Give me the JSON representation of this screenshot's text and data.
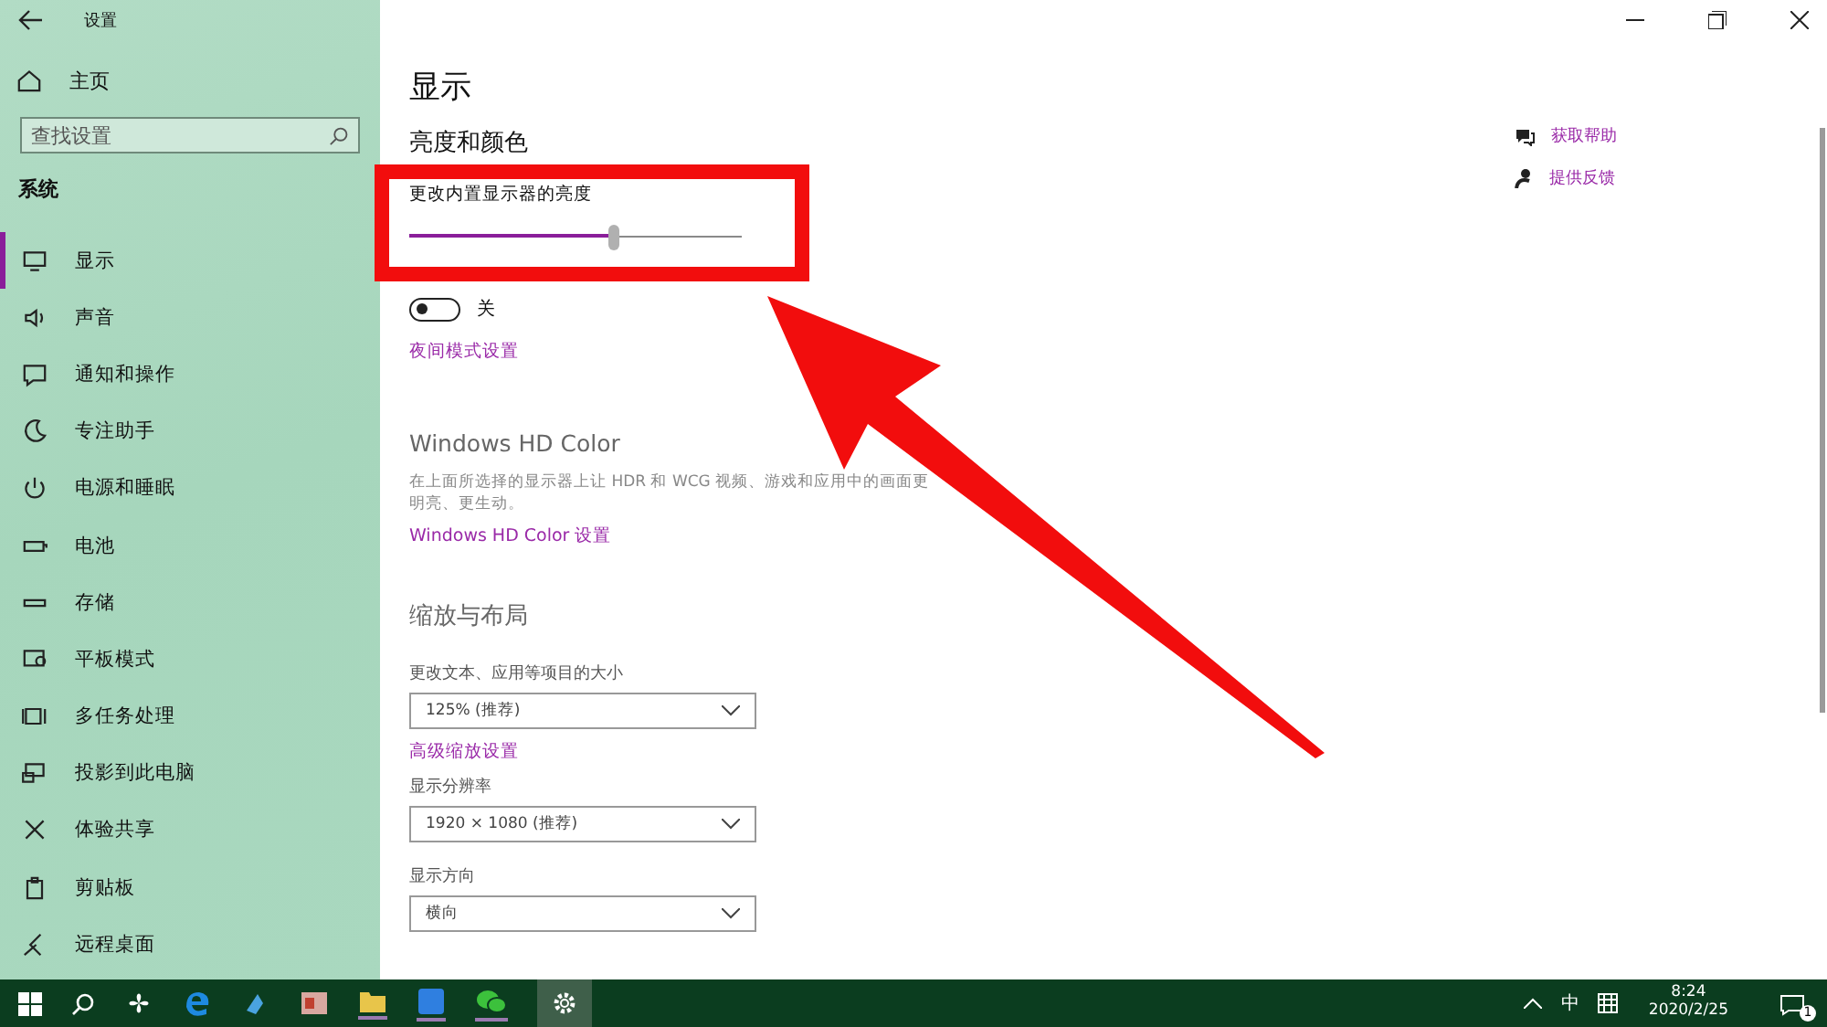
{
  "window": {
    "title": "设置"
  },
  "sidebar": {
    "home": "主页",
    "search_placeholder": "查找设置",
    "section": "系统",
    "items": [
      {
        "label": "显示",
        "selected": true
      },
      {
        "label": "声音",
        "selected": false
      },
      {
        "label": "通知和操作",
        "selected": false
      },
      {
        "label": "专注助手",
        "selected": false
      },
      {
        "label": "电源和睡眠",
        "selected": false
      },
      {
        "label": "电池",
        "selected": false
      },
      {
        "label": "存储",
        "selected": false
      },
      {
        "label": "平板模式",
        "selected": false
      },
      {
        "label": "多任务处理",
        "selected": false
      },
      {
        "label": "投影到此电脑",
        "selected": false
      },
      {
        "label": "体验共享",
        "selected": false
      },
      {
        "label": "剪贴板",
        "selected": false
      },
      {
        "label": "远程桌面",
        "selected": false
      }
    ]
  },
  "page": {
    "title": "显示",
    "brightness": {
      "heading": "亮度和颜色",
      "label": "更改内置显示器的亮度",
      "level": 0.62
    },
    "night_light": {
      "on": false,
      "state_text": "关",
      "link": "夜间模式设置"
    },
    "hd_color": {
      "heading": "Windows HD Color",
      "description": "在上面所选择的显示器上让 HDR 和 WCG 视频、游戏和应用中的画面更明亮、更生动。",
      "link": "Windows HD Color 设置"
    },
    "scale": {
      "heading": "缩放与布局",
      "size_label": "更改文本、应用等项目的大小",
      "size_value": "125% (推荐)",
      "advanced_link": "高级缩放设置",
      "resolution_label": "显示分辨率",
      "resolution_value": "1920 × 1080 (推荐)",
      "orientation_label": "显示方向",
      "orientation_value": "横向"
    }
  },
  "help": {
    "items": [
      "获取帮助",
      "提供反馈"
    ]
  },
  "taskbar": {
    "ime": "中",
    "time": "8:24",
    "date": "2020/2/25",
    "notifications": "1"
  }
}
